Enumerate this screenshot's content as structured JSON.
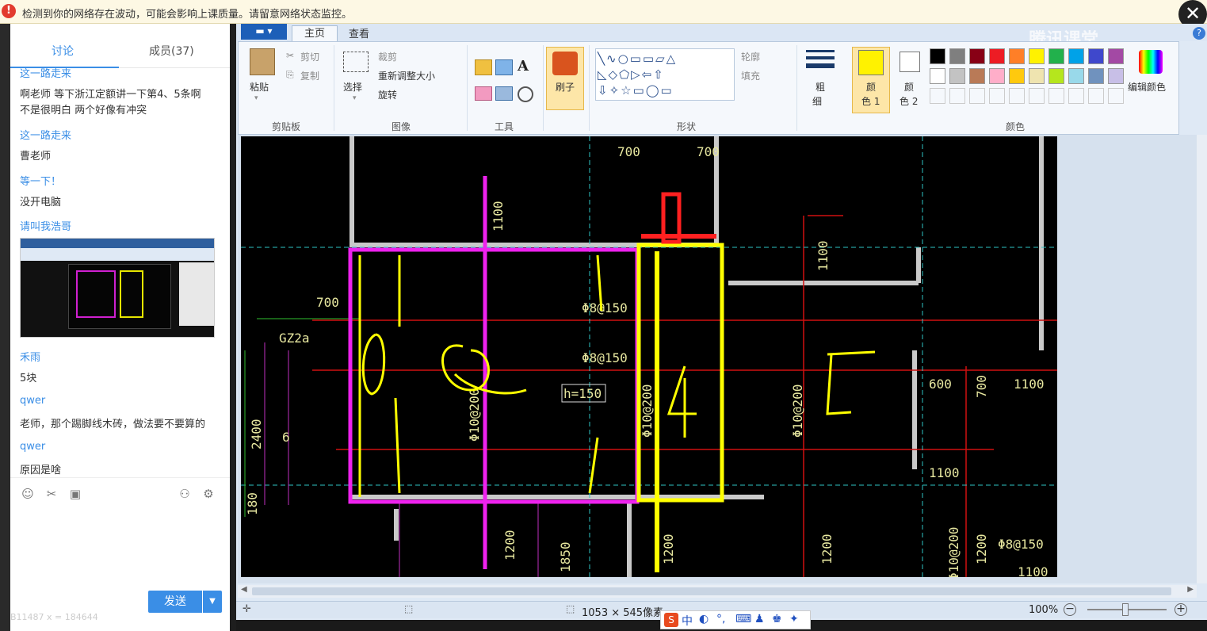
{
  "warning": {
    "text": "检测到你的网络存在波动，可能会影响上课质量。请留意网络状态监控。"
  },
  "chat": {
    "tabs": {
      "discuss": "讨论",
      "members": "成员(37)"
    },
    "messages": [
      {
        "name": "这一路走来",
        "text": ""
      },
      {
        "name": "",
        "text": "啊老师 等下浙江定额讲一下第4、5条啊"
      },
      {
        "name": "",
        "text": "不是很明白 两个好像有冲突"
      },
      {
        "name": "这一路走来",
        "text": "曹老师"
      },
      {
        "name": "等一下！",
        "text": "没开电脑"
      },
      {
        "name": "请叫我浩哥",
        "text": ""
      },
      {
        "name": "禾雨",
        "text": "5块"
      },
      {
        "name": "qwer",
        "text": "老师，那个踢脚线木砖，做法要不要算的"
      },
      {
        "name": "qwer",
        "text": "原因是啥"
      }
    ],
    "send_label": "发送",
    "coord_text": "B11487 x = 184644"
  },
  "paint": {
    "file_label": "▬ ▾",
    "tabs": {
      "home": "主页",
      "view": "查看"
    },
    "clipboard": {
      "paste": "粘贴",
      "cut": "剪切",
      "copy": "复制",
      "group": "剪贴板"
    },
    "image": {
      "select": "选择",
      "crop": "裁剪",
      "resize": "重新调整大小",
      "rotate": "旋转",
      "group": "图像"
    },
    "tools": {
      "group": "工具"
    },
    "brush": {
      "label": "刷子"
    },
    "shapes": {
      "outline": "轮廓",
      "fill": "填充",
      "group": "形状"
    },
    "size": {
      "label1": "粗",
      "label2": "细"
    },
    "color1": {
      "label1": "颜",
      "label2": "色 1"
    },
    "color2": {
      "label1": "颜",
      "label2": "色 2"
    },
    "colors": {
      "group": "颜色",
      "edit": "编辑颜色"
    },
    "palette_row1": [
      "#000000",
      "#7f7f7f",
      "#880015",
      "#ed1c24",
      "#ff7f27",
      "#fff200",
      "#22b14c",
      "#00a2e8",
      "#3f48cc",
      "#a349a4"
    ],
    "palette_row2": [
      "#ffffff",
      "#c3c3c3",
      "#b97a57",
      "#ffaec9",
      "#ffc90e",
      "#efe4b0",
      "#b5e61d",
      "#99d9ea",
      "#7092be",
      "#c8bfe7"
    ],
    "color1_value": "#fff200",
    "color2_value": "#ffffff",
    "status": {
      "dimensions": "1053 × 545像素",
      "zoom": "100%"
    },
    "watermark": "腾讯课堂"
  },
  "cad": {
    "labels": [
      "700",
      "700",
      "700",
      "GZ2a",
      "1100",
      "Φ8@150",
      "Φ8@150",
      "h=150",
      "Φ10@200",
      "Φ10@200",
      "Φ10@200",
      "Φ10@200",
      "2400",
      "6",
      "180",
      "1100",
      "600",
      "700",
      "1100",
      "1100",
      "1200",
      "1200",
      "1200",
      "1200",
      "1850",
      "Φ8@150",
      "1100"
    ]
  }
}
